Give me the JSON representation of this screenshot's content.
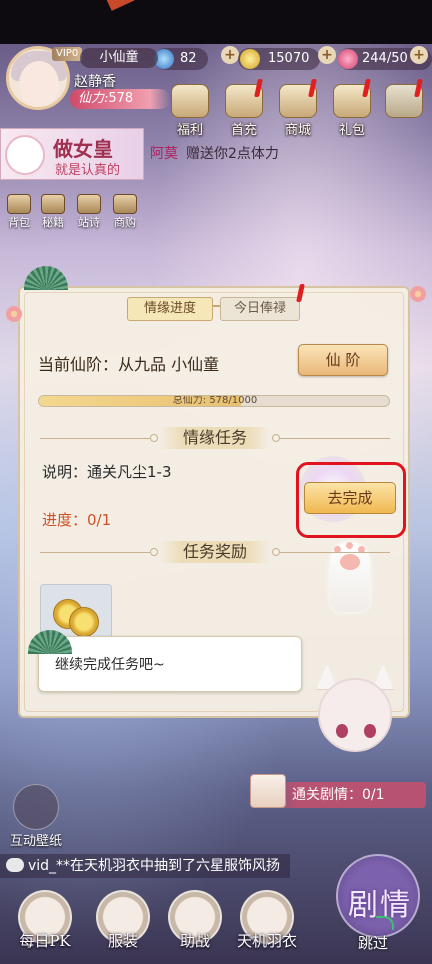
{
  "resources": {
    "rank": "小仙童",
    "vip": "VIP0",
    "gems": "82",
    "coins": "15070",
    "energy": "244/50"
  },
  "player": {
    "name": "赵静香",
    "power_label": "仙力:",
    "power_value": "578"
  },
  "top_menu": [
    "福利",
    "首充",
    "商城",
    "礼包"
  ],
  "banner": {
    "title": "做女皇",
    "subtitle": "就是认真的"
  },
  "notice": {
    "from": "阿莫",
    "text": "赠送你2点体力"
  },
  "small_menu": [
    "背包",
    "秘籍",
    "站诗",
    "商购"
  ],
  "panel": {
    "tab_active": "情缘进度",
    "tab_inactive": "今日俸禄",
    "realm_text": "当前仙阶：从九品 小仙童",
    "realm_button": "仙 阶",
    "progress_text": "总仙力: 578/1000",
    "progress_fraction": 0.578,
    "section_task": "情缘任务",
    "description": "说明：通关凡尘1-3",
    "progress_label": "进度：0/1",
    "go_button": "去完成",
    "section_reward": "任务奖励"
  },
  "tip": "继续完成任务吧~",
  "clear_plot": "通关剧情：0/1",
  "wallpaper_label": "互动壁纸",
  "chat": "vid_**在天机羽衣中抽到了六星服饰风扬",
  "bottom_menu": [
    "每日PK",
    "服装",
    "助战",
    "天机羽衣"
  ],
  "plot_button": "剧情",
  "skip_button": "跳过",
  "colors": {
    "highlight": "#e0141e",
    "progress_red": "#d05028",
    "notice_name": "#b02060"
  }
}
